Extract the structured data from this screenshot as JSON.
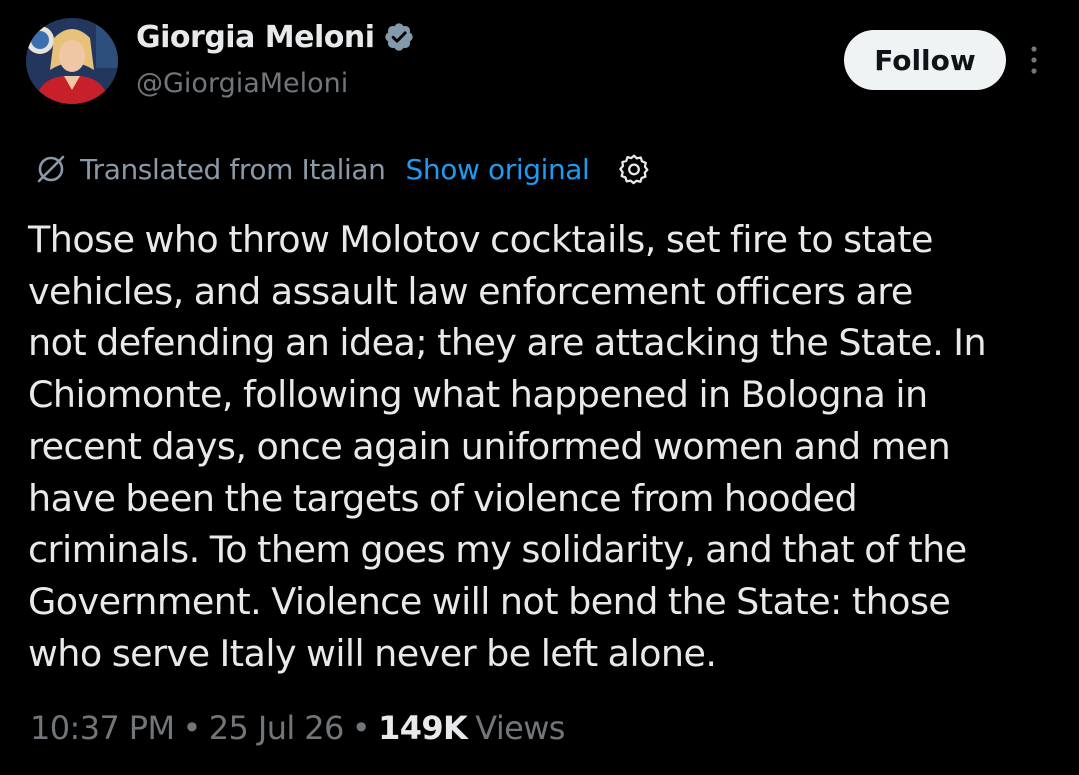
{
  "author": {
    "display_name": "Giorgia Meloni",
    "handle": "@GiorgiaMeloni",
    "verified": true,
    "avatar_icon": "profile-photo"
  },
  "actions": {
    "follow_label": "Follow",
    "more_icon": "more-vertical-icon"
  },
  "translation": {
    "icon": "translate-icon",
    "label": "Translated from Italian",
    "show_original_label": "Show original",
    "settings_icon": "gear-icon"
  },
  "tweet": {
    "text": "Those who throw Molotov cocktails, set fire to state\nvehicles, and assault law enforcement officers are\nnot defending an idea; they are attacking the State. In\nChiomonte, following what happened in Bologna in\nrecent days, once again uniformed women and men\nhave been the targets of violence from hooded\ncriminals. To them goes my solidarity, and that of the\nGovernment. Violence will not bend the State: those\nwho serve Italy will never be left alone."
  },
  "meta": {
    "time": "10:37 PM",
    "separator": "•",
    "date": "25 Jul 26",
    "views_count": "149K",
    "views_label": "Views"
  },
  "colors": {
    "background": "#000000",
    "text_primary": "#e7e9ea",
    "text_secondary": "#71767b",
    "link": "#1d9bf0",
    "verified": "#829aab",
    "follow_bg": "#eff3f4"
  }
}
